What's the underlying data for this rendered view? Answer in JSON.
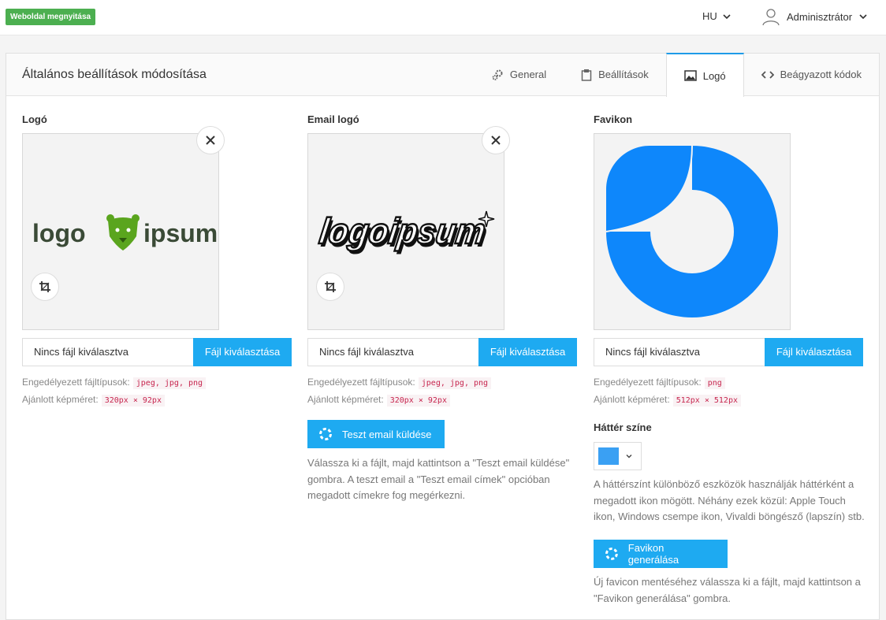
{
  "topbar": {
    "open_site": "Weboldal megnyitása",
    "lang": "HU",
    "user": "Adminisztrátor"
  },
  "panel": {
    "title": "Általános beállítások módosítása",
    "tabs": [
      {
        "label": "General",
        "icon": "gears-icon"
      },
      {
        "label": "Beállítások",
        "icon": "clipboard-icon"
      },
      {
        "label": "Logó",
        "icon": "image-icon",
        "active": true
      },
      {
        "label": "Beágyazott kódok",
        "icon": "code-icon"
      }
    ]
  },
  "logo": {
    "label": "Logó",
    "file_placeholder": "Nincs fájl kiválasztva",
    "file_button": "Fájl kiválasztása",
    "types_label": "Engedélyezett fájltípusok:",
    "types": "jpeg, jpg, png",
    "size_label": "Ajánlott képméret:",
    "size": "320px × 92px",
    "image_text_left": "logo",
    "image_text_right": "ipsum"
  },
  "email_logo": {
    "label": "Email logó",
    "file_placeholder": "Nincs fájl kiválasztva",
    "file_button": "Fájl kiválasztása",
    "types_label": "Engedélyezett fájltípusok:",
    "types": "jpeg, jpg, png",
    "size_label": "Ajánlott képméret:",
    "size": "320px × 92px",
    "image_text": "logoipsum",
    "test_button": "Teszt email küldése",
    "help": "Válassza ki a fájlt, majd kattintson a \"Teszt email küldése\" gombra. A teszt email a \"Teszt email címek\" opcióban megadott címekre fog megérkezni."
  },
  "favicon": {
    "label": "Favikon",
    "file_placeholder": "Nincs fájl kiválasztva",
    "file_button": "Fájl kiválasztása",
    "types_label": "Engedélyezett fájltípusok:",
    "types": "png",
    "size_label": "Ajánlott képméret:",
    "size": "512px × 512px",
    "bg_label": "Háttér színe",
    "bg_color": "#3aa0f3",
    "bg_help": "A háttérszínt különböző eszközök használják háttérként a megadott ikon mögött. Néhány ezek közül: Apple Touch ikon, Windows csempe ikon, Vivaldi böngésző (lapszín) stb.",
    "generate_button": "Favikon generálása",
    "generate_help": "Új favicon mentéséhez válassza ki a fájlt, majd kattintson a \"Favikon generálása\" gombra."
  },
  "colors": {
    "accent": "#1eaaf1",
    "green": "#4caf50",
    "logo_green": "#5aa51e",
    "favicon_blue": "#0e87fb"
  }
}
